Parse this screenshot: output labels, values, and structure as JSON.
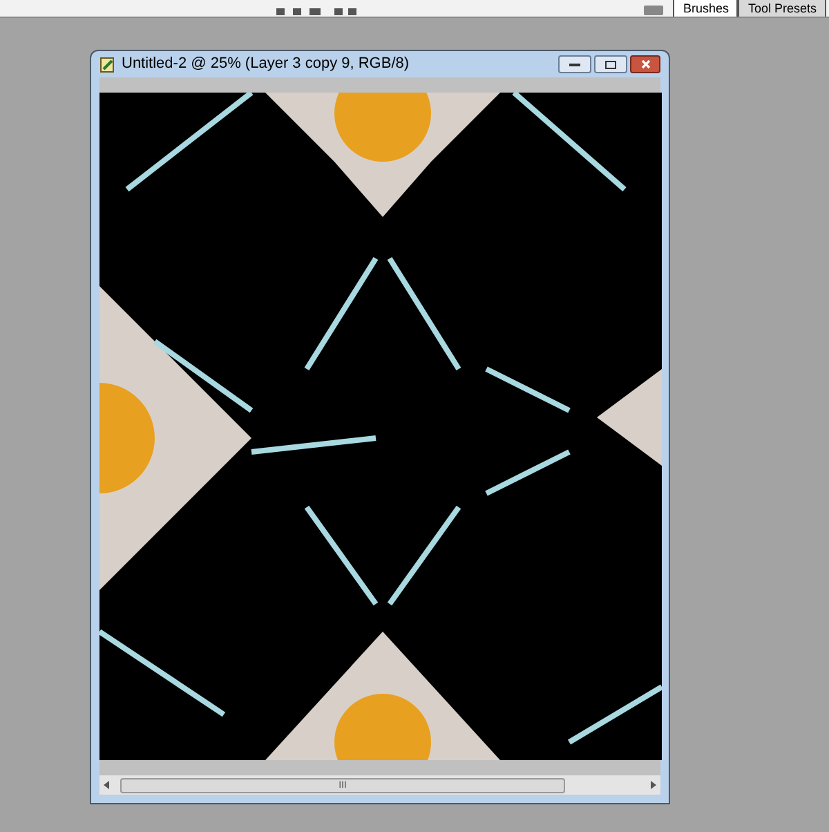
{
  "panel_tabs": [
    {
      "label": "Brushes",
      "selected": true
    },
    {
      "label": "Tool Presets",
      "selected": false
    }
  ],
  "document_window": {
    "title": "Untitled-2 @ 25% (Layer 3 copy 9, RGB/8)",
    "scrollbar_grip": "III"
  }
}
